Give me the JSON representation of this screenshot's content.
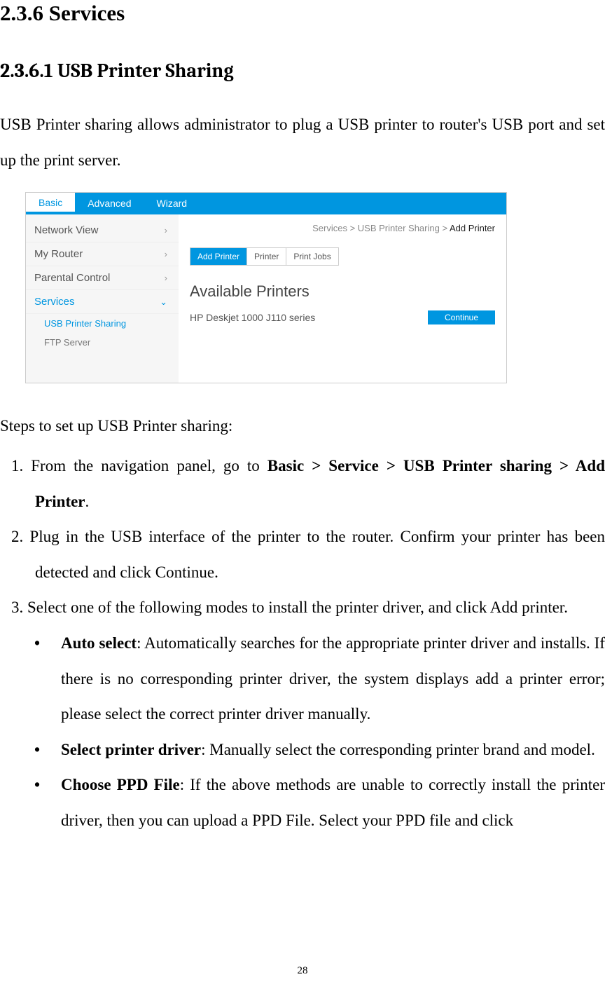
{
  "headings": {
    "h1": "2.3.6 Services",
    "h2": "2.3.6.1 USB Printer Sharing"
  },
  "intro_para": "USB Printer sharing allows administrator to plug a USB printer to router's USB port and set up the print server.",
  "screenshot": {
    "top_tabs": [
      "Basic",
      "Advanced",
      "Wizard"
    ],
    "top_active_index": 0,
    "sidebar": {
      "items": [
        {
          "label": "Network View",
          "chevron": "right",
          "active": false
        },
        {
          "label": "My Router",
          "chevron": "right",
          "active": false
        },
        {
          "label": "Parental Control",
          "chevron": "right",
          "active": false
        },
        {
          "label": "Services",
          "chevron": "down",
          "active": true
        }
      ],
      "subs": [
        {
          "label": "USB Printer Sharing",
          "active": true
        },
        {
          "label": "FTP Server",
          "active": false
        }
      ]
    },
    "breadcrumb": {
      "parts": [
        "Services",
        "USB Printer Sharing"
      ],
      "sep": " > ",
      "current": "Add Printer"
    },
    "subtabs": {
      "items": [
        "Add Printer",
        "Printer",
        "Print Jobs"
      ],
      "active_index": 0
    },
    "available_title": "Available Printers",
    "printer_name": "HP Deskjet 1000 J110 series",
    "continue_label": "Continue"
  },
  "steps_intro": "Steps to set up USB Printer sharing:",
  "steps": [
    {
      "pre": "From the navigation panel, go to ",
      "bold": "Basic > Service > USB Printer sharing > Add Printer",
      "post": "."
    },
    {
      "text": "Plug in the USB interface of the printer to the router. Confirm your printer has been detected and click Continue."
    },
    {
      "text": "Select one of the following modes to install the printer driver, and click Add printer."
    }
  ],
  "bullets": [
    {
      "bold": "Auto select",
      "rest": ": Automatically searches for the appropriate printer driver and installs. If there is no corresponding printer driver, the system displays add a printer error; please select the correct printer driver manually."
    },
    {
      "bold": "Select printer driver",
      "rest": ": Manually select the corresponding printer brand and model."
    },
    {
      "bold": "Choose PPD File",
      "rest": ": If the above methods are unable to correctly install the printer driver, then you can upload a PPD File. Select your PPD file and click"
    }
  ],
  "page_number": "28"
}
